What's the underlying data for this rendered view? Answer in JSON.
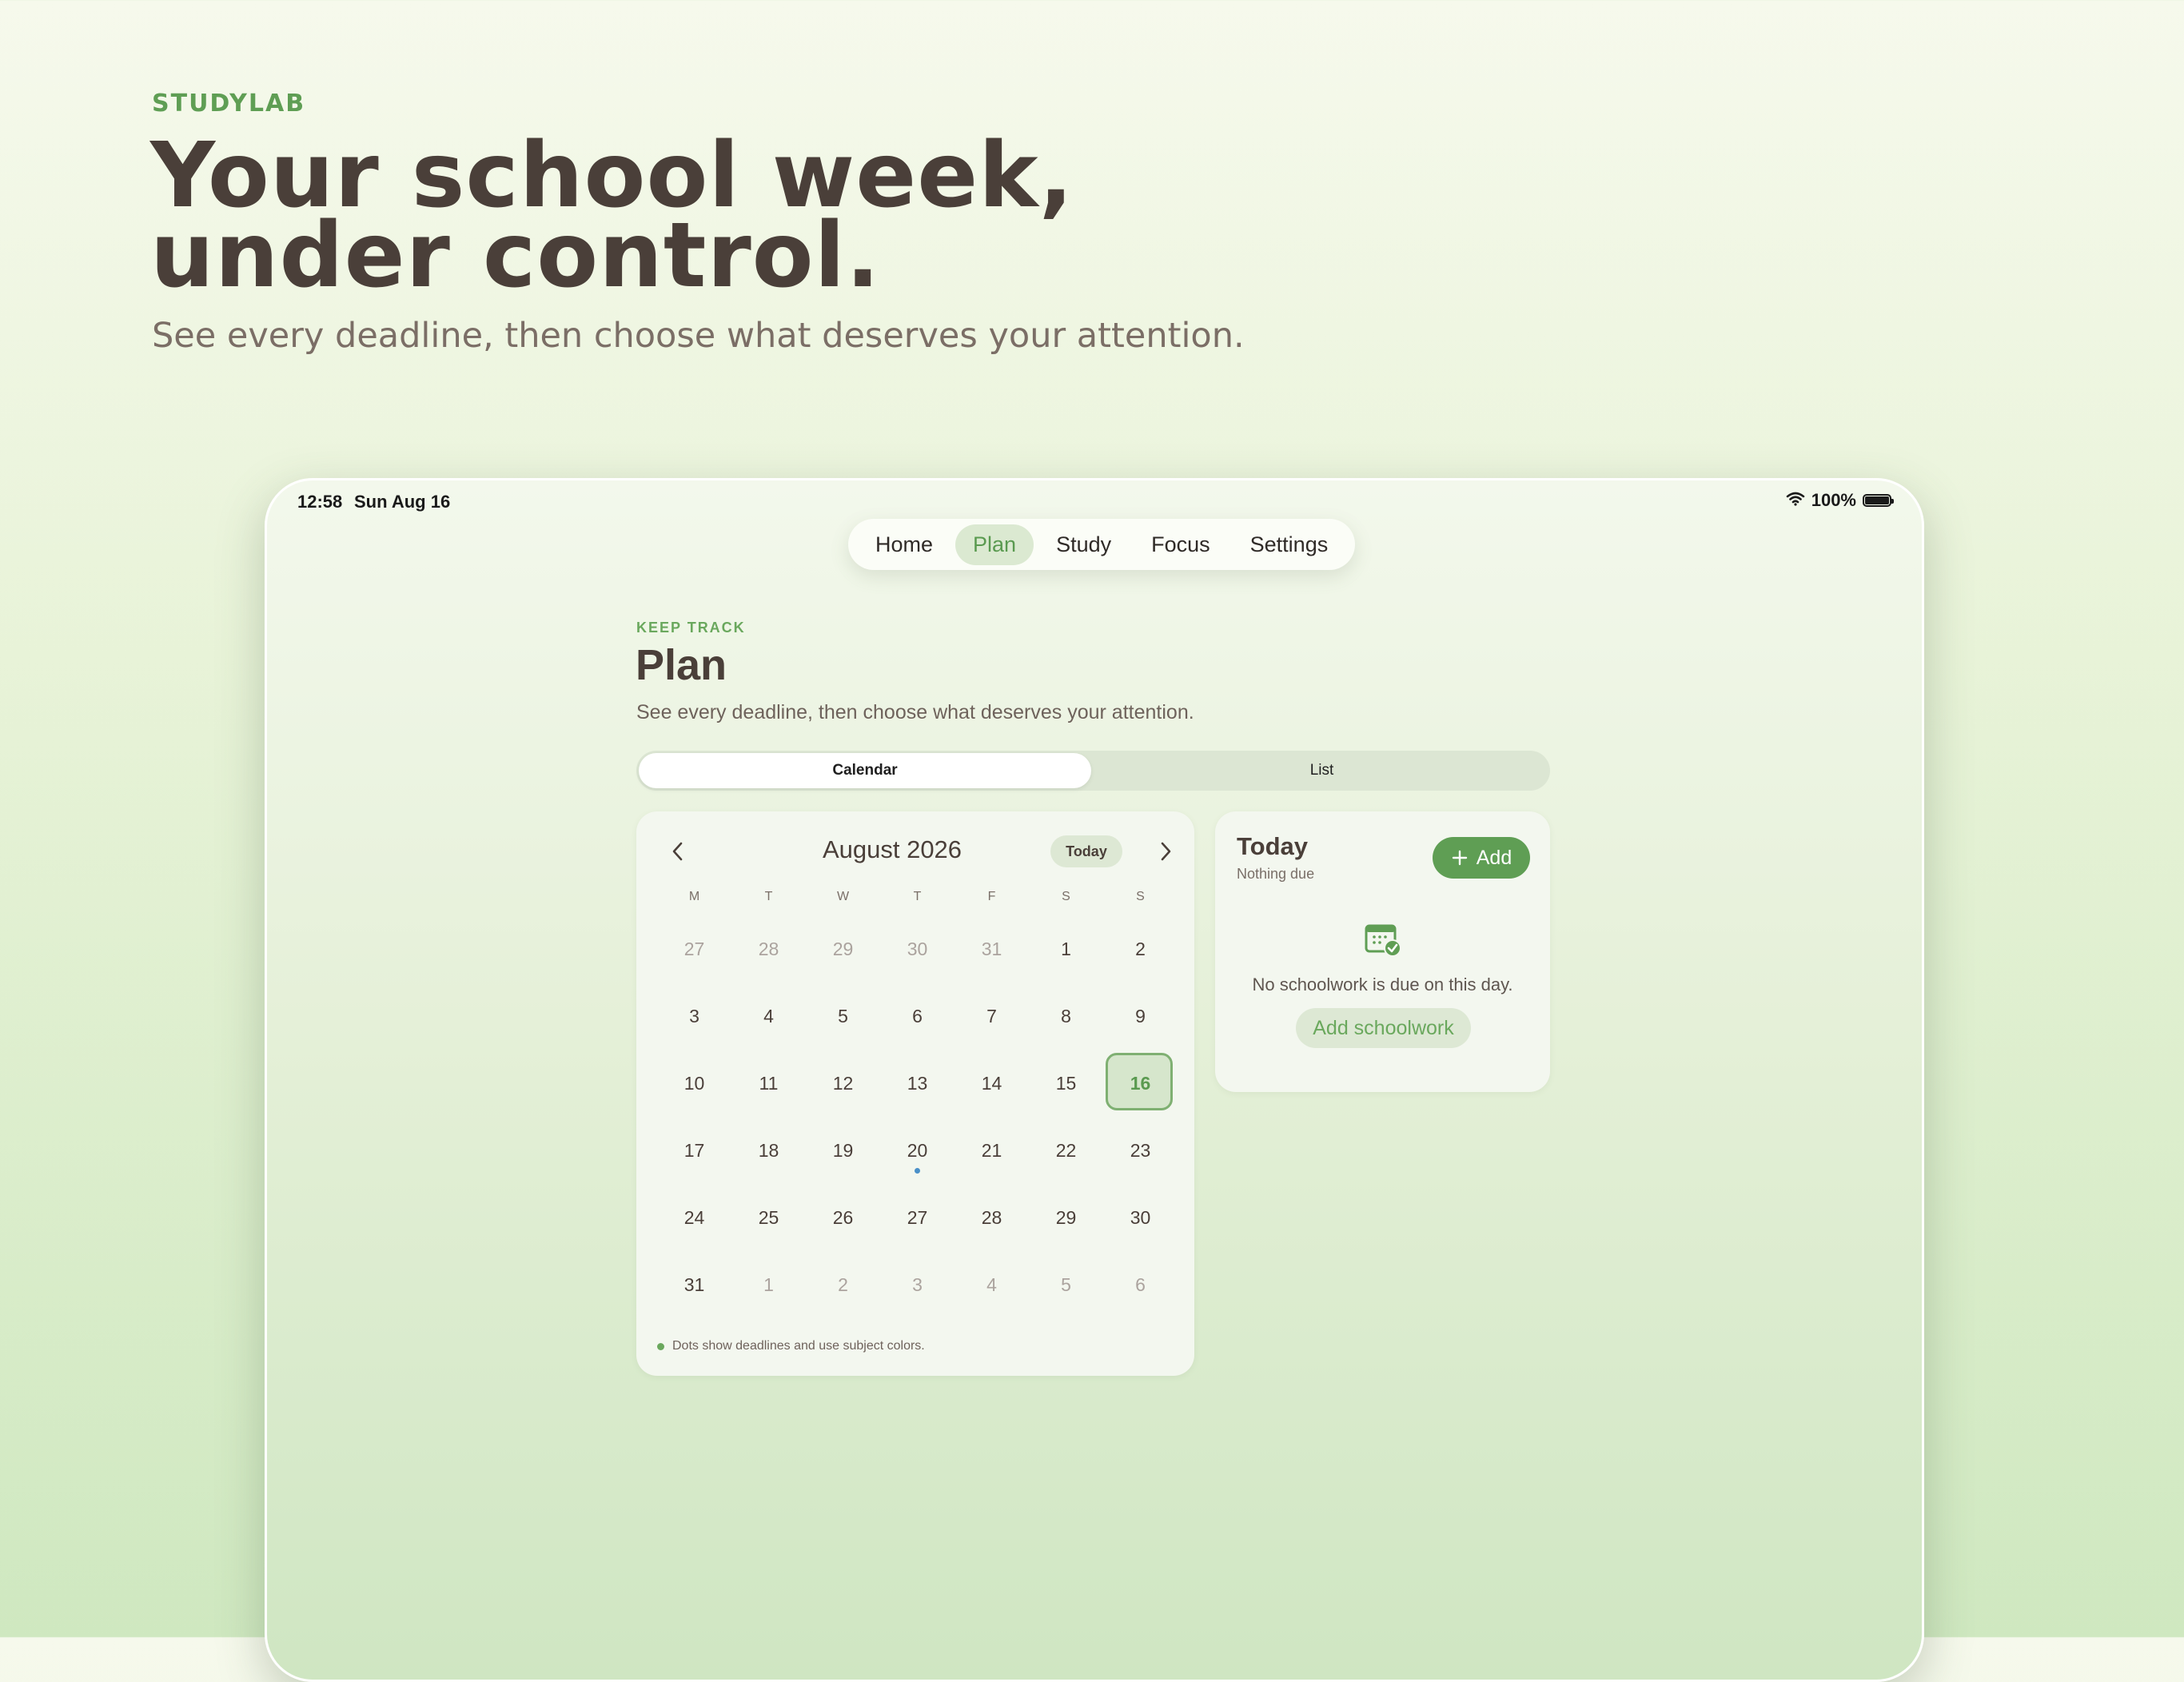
{
  "hero": {
    "brand": "STUDYLAB",
    "headline_line1": "Your school week,",
    "headline_line2": "under control.",
    "subtitle": "See every deadline, then choose what deserves your attention."
  },
  "status_bar": {
    "time": "12:58",
    "date": "Sun Aug 16",
    "battery": "100%",
    "battery_level": 1.0,
    "icons": [
      "wifi-icon",
      "battery-icon"
    ]
  },
  "nav": {
    "items": [
      {
        "label": "Home"
      },
      {
        "label": "Plan",
        "active": true
      },
      {
        "label": "Study"
      },
      {
        "label": "Focus"
      },
      {
        "label": "Settings"
      }
    ]
  },
  "page": {
    "eyebrow": "KEEP TRACK",
    "title": "Plan",
    "subtitle": "See every deadline, then choose what deserves your attention."
  },
  "segmented": {
    "options": [
      "Calendar",
      "List"
    ],
    "selected": "Calendar"
  },
  "calendar": {
    "month_label": "August 2026",
    "today_button": "Today",
    "weekdays": [
      "M",
      "T",
      "W",
      "T",
      "F",
      "S",
      "S"
    ],
    "days": [
      {
        "n": "27",
        "muted": true
      },
      {
        "n": "28",
        "muted": true
      },
      {
        "n": "29",
        "muted": true
      },
      {
        "n": "30",
        "muted": true
      },
      {
        "n": "31",
        "muted": true
      },
      {
        "n": "1"
      },
      {
        "n": "2"
      },
      {
        "n": "3"
      },
      {
        "n": "4"
      },
      {
        "n": "5"
      },
      {
        "n": "6"
      },
      {
        "n": "7"
      },
      {
        "n": "8"
      },
      {
        "n": "9"
      },
      {
        "n": "10"
      },
      {
        "n": "11"
      },
      {
        "n": "12"
      },
      {
        "n": "13"
      },
      {
        "n": "14"
      },
      {
        "n": "15"
      },
      {
        "n": "16",
        "selected": true
      },
      {
        "n": "17"
      },
      {
        "n": "18"
      },
      {
        "n": "19"
      },
      {
        "n": "20",
        "dot": true
      },
      {
        "n": "21"
      },
      {
        "n": "22"
      },
      {
        "n": "23"
      },
      {
        "n": "24"
      },
      {
        "n": "25"
      },
      {
        "n": "26"
      },
      {
        "n": "27"
      },
      {
        "n": "28"
      },
      {
        "n": "29"
      },
      {
        "n": "30"
      },
      {
        "n": "31"
      },
      {
        "n": "1",
        "muted": true
      },
      {
        "n": "2",
        "muted": true
      },
      {
        "n": "3",
        "muted": true
      },
      {
        "n": "4",
        "muted": true
      },
      {
        "n": "5",
        "muted": true
      },
      {
        "n": "6",
        "muted": true
      }
    ],
    "legend": "Dots show deadlines and use subject colors."
  },
  "today_panel": {
    "title": "Today",
    "subtitle": "Nothing due",
    "add_label": "Add",
    "empty_text": "No schoolwork is due on this day.",
    "add_schoolwork_label": "Add schoolwork"
  },
  "colors": {
    "accent": "#5f9e54",
    "headline": "#4a3f39",
    "deadline_dot": "#4a90c8"
  }
}
